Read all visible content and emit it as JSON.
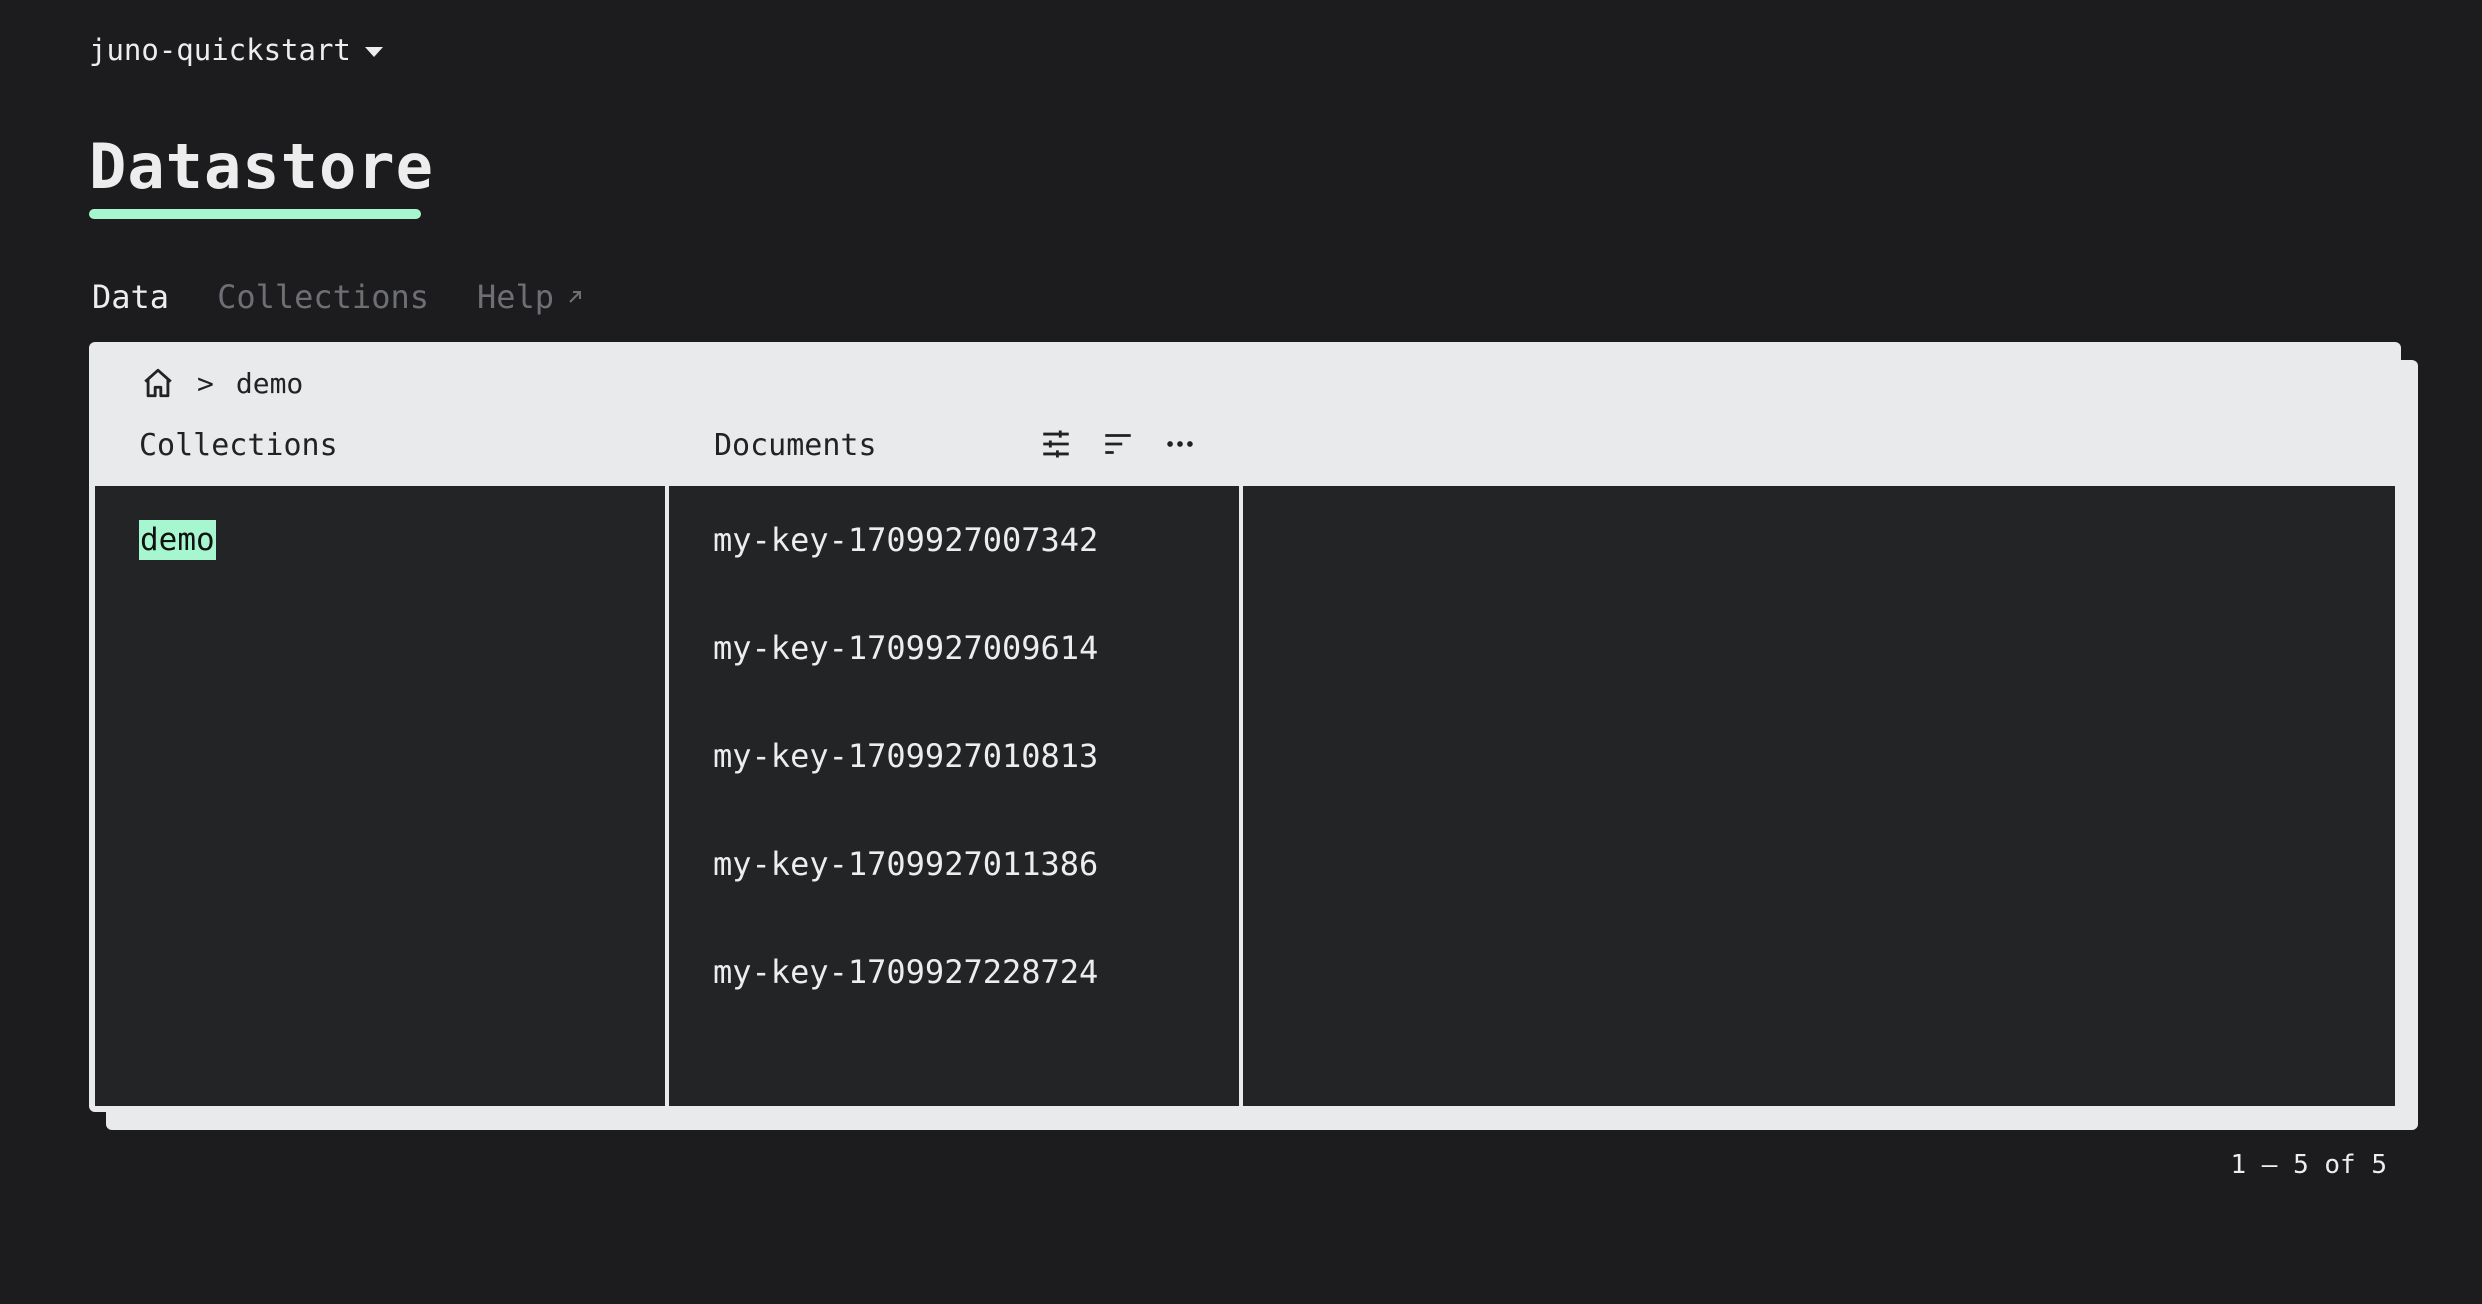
{
  "header": {
    "satellite_name": "juno-quickstart",
    "page_title": "Datastore"
  },
  "tabs": [
    {
      "label": "Data",
      "active": true
    },
    {
      "label": "Collections",
      "active": false
    },
    {
      "label": "Help",
      "active": false,
      "external": true
    }
  ],
  "breadcrumb": {
    "separator": ">",
    "current": "demo"
  },
  "columns": {
    "collections_header": "Collections",
    "documents_header": "Documents"
  },
  "collections": [
    "demo"
  ],
  "selected_collection": "demo",
  "documents": [
    "my-key-1709927007342",
    "my-key-1709927009614",
    "my-key-1709927010813",
    "my-key-1709927011386",
    "my-key-1709927228724"
  ],
  "pagination": "1 – 5 of 5",
  "colors": {
    "background": "#1c1c1e",
    "accent": "#a6f7cf",
    "panel": "#e9eaec",
    "column_bg": "#232426"
  },
  "icons": {
    "satellite_dropdown": "caret-down-icon",
    "help_external": "external-link-icon",
    "breadcrumb_home": "home-icon",
    "filter": "filter-icon",
    "sort": "sort-icon",
    "more": "more-icon"
  }
}
